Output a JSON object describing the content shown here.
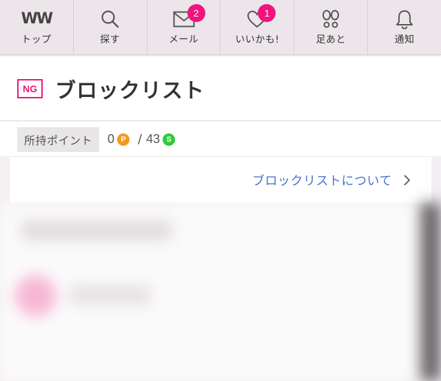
{
  "nav": {
    "items": [
      {
        "label": "トップ",
        "icon": "ww-logo-icon",
        "badge": ""
      },
      {
        "label": "探す",
        "icon": "search-icon",
        "badge": ""
      },
      {
        "label": "メール",
        "icon": "mail-icon",
        "badge": "2"
      },
      {
        "label": "いいかも!",
        "icon": "heart-icon",
        "badge": "1"
      },
      {
        "label": "足あと",
        "icon": "footprints-icon",
        "badge": ""
      },
      {
        "label": "通知",
        "icon": "bell-icon",
        "badge": ""
      }
    ],
    "logo_text": "WW"
  },
  "page": {
    "icon_text": "NG",
    "title": "ブロックリスト"
  },
  "points": {
    "label": "所持ポイント",
    "p_value": "0",
    "p_icon": "P",
    "separator": "/",
    "s_value": "43",
    "s_icon": "S"
  },
  "about": {
    "link_text": "ブロックリストについて"
  },
  "colors": {
    "accent": "#f0147d",
    "link": "#4a74c9",
    "nav_bg": "#ece6ea"
  }
}
